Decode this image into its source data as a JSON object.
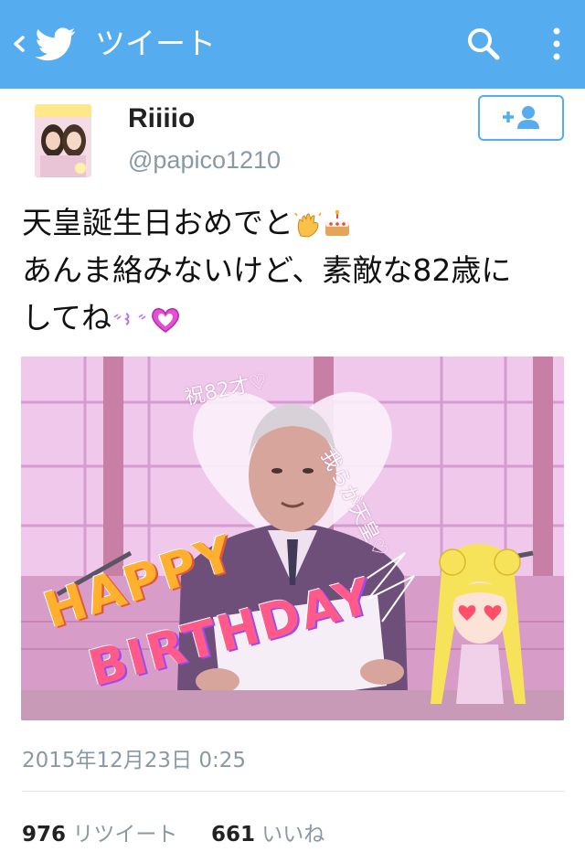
{
  "topbar": {
    "title": "ツイート",
    "back_icon": "chevron-left-icon",
    "logo_icon": "twitter-bird-icon",
    "search_icon": "search-icon",
    "menu_icon": "more-vertical-icon",
    "color": "#55acee"
  },
  "author": {
    "name": "Riiiio",
    "handle": "@papico1210",
    "follow_icon": "follow-user-icon"
  },
  "tweet": {
    "line1": "天皇誕生日おめでと",
    "line2": "あんま絡みないけど、素敵な82歳に",
    "line3": "してね"
  },
  "media": {
    "overlay_text": {
      "happy": "HAPPY",
      "birthday": "BIRTHDAY",
      "handwriting_left": "祝82才♡",
      "handwriting_right": "我らが天皇♡"
    }
  },
  "footer": {
    "timestamp": "2015年12月23日 0:25",
    "retweet_count": "976",
    "retweet_label": "リツイート",
    "like_count": "661",
    "like_label": "いいね"
  }
}
